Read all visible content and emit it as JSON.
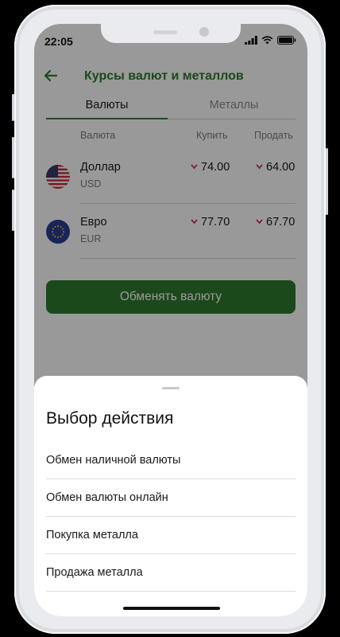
{
  "status_bar": {
    "time": "22:05"
  },
  "header": {
    "title": "Курсы валют и металлов",
    "back_icon": "arrow-left-icon"
  },
  "tabs": [
    {
      "label": "Валюты",
      "active": true
    },
    {
      "label": "Металлы",
      "active": false
    }
  ],
  "table": {
    "columns": [
      "Валюта",
      "Купить",
      "Продать"
    ],
    "rows": [
      {
        "name": "Доллар",
        "code": "USD",
        "flag": "us-flag-icon",
        "buy": "74.00",
        "sell": "64.00",
        "buy_trend": "down",
        "sell_trend": "down"
      },
      {
        "name": "Евро",
        "code": "EUR",
        "flag": "eu-flag-icon",
        "buy": "77.70",
        "sell": "67.70",
        "buy_trend": "down",
        "sell_trend": "down"
      }
    ]
  },
  "exchange_button": {
    "label": "Обменять валюту"
  },
  "sheet": {
    "title": "Выбор действия",
    "items": [
      "Обмен наличной валюты",
      "Обмен валюты онлайн",
      "Покупка металла",
      "Продажа металла"
    ]
  },
  "colors": {
    "brand_green": "#2f7a2e",
    "trend_down": "#e0343c"
  }
}
